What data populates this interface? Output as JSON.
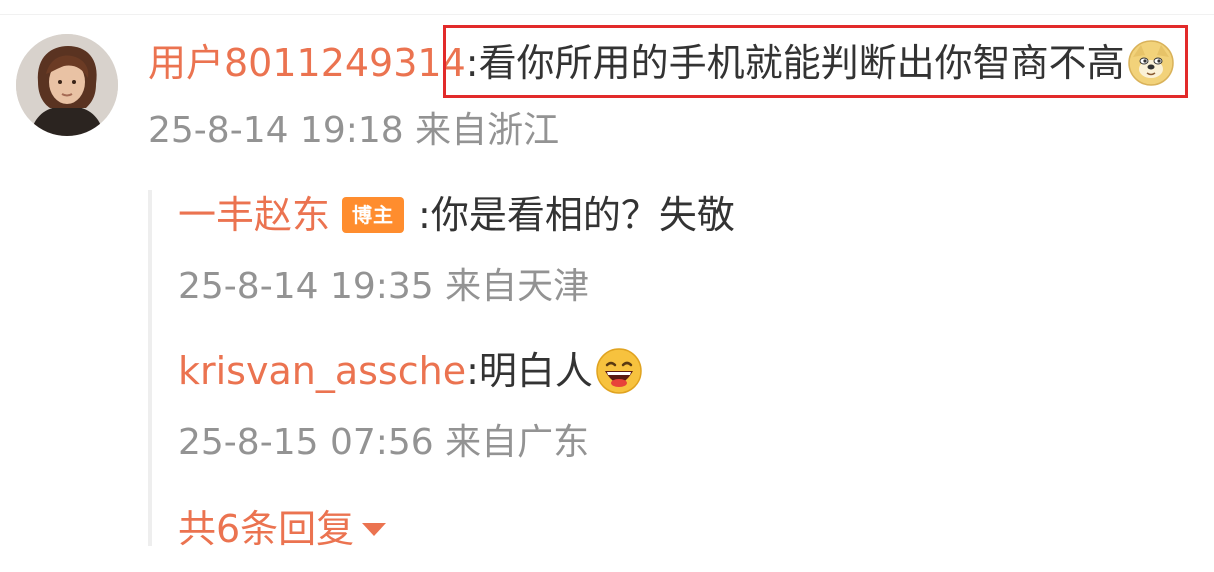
{
  "comment": {
    "username": "用户8011249314",
    "separator": ":",
    "text": "看你所用的手机就能判断出你智商不高",
    "emoji_icon": "doge-emoji-icon",
    "meta": "25-8-14 19:18 来自浙江"
  },
  "replies": [
    {
      "username": "一丰赵东",
      "badge": "博主",
      "text": " :你是看相的？失敬",
      "meta": "25-8-14 19:35 来自天津"
    },
    {
      "username": "krisvan_assche",
      "text": ":明白人",
      "emoji_icon": "laughing-emoji-icon",
      "meta": "25-8-15 07:56 来自广东"
    }
  ],
  "more_replies": "共6条回复",
  "colors": {
    "username": "#eb7350",
    "badge_bg": "#ff8d2e",
    "meta": "#939393",
    "highlight": "#e22a2a"
  }
}
